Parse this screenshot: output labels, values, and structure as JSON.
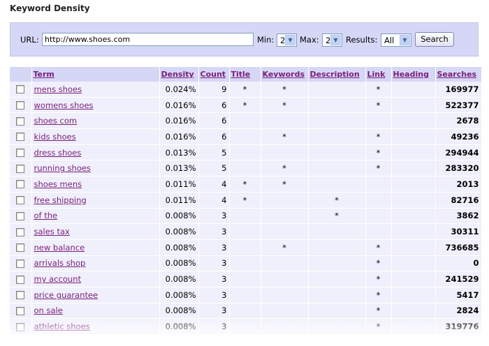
{
  "title": "Keyword Density",
  "search": {
    "url_label": "URL:",
    "url_value": "http://www.shoes.com",
    "min_label": "Min:",
    "min_value": "2",
    "max_label": "Max:",
    "max_value": "2",
    "results_label": "Results:",
    "results_value": "All",
    "button_label": "Search"
  },
  "table": {
    "headers": [
      "Term",
      "Density",
      "Count",
      "Title",
      "Keywords",
      "Description",
      "Link",
      "Heading",
      "Searches"
    ],
    "rows": [
      {
        "term": "mens shoes",
        "density": "0.024%",
        "count": "9",
        "title": "*",
        "keywords": "*",
        "description": "",
        "link": "*",
        "heading": "",
        "searches": "169977"
      },
      {
        "term": "womens shoes",
        "density": "0.016%",
        "count": "6",
        "title": "*",
        "keywords": "*",
        "description": "",
        "link": "*",
        "heading": "",
        "searches": "522377"
      },
      {
        "term": "shoes com",
        "density": "0.016%",
        "count": "6",
        "title": "",
        "keywords": "",
        "description": "",
        "link": "",
        "heading": "",
        "searches": "2678"
      },
      {
        "term": "kids shoes",
        "density": "0.016%",
        "count": "6",
        "title": "",
        "keywords": "*",
        "description": "",
        "link": "*",
        "heading": "",
        "searches": "49236"
      },
      {
        "term": "dress shoes",
        "density": "0.013%",
        "count": "5",
        "title": "",
        "keywords": "",
        "description": "",
        "link": "*",
        "heading": "",
        "searches": "294944"
      },
      {
        "term": "running shoes",
        "density": "0.013%",
        "count": "5",
        "title": "",
        "keywords": "*",
        "description": "",
        "link": "*",
        "heading": "",
        "searches": "283320"
      },
      {
        "term": "shoes mens",
        "density": "0.011%",
        "count": "4",
        "title": "*",
        "keywords": "*",
        "description": "",
        "link": "",
        "heading": "",
        "searches": "2013"
      },
      {
        "term": "free shipping",
        "density": "0.011%",
        "count": "4",
        "title": "*",
        "keywords": "",
        "description": "*",
        "link": "",
        "heading": "",
        "searches": "82716"
      },
      {
        "term": "of the",
        "density": "0.008%",
        "count": "3",
        "title": "",
        "keywords": "",
        "description": "*",
        "link": "",
        "heading": "",
        "searches": "3862"
      },
      {
        "term": "sales tax",
        "density": "0.008%",
        "count": "3",
        "title": "",
        "keywords": "",
        "description": "",
        "link": "",
        "heading": "",
        "searches": "30311"
      },
      {
        "term": "new balance",
        "density": "0.008%",
        "count": "3",
        "title": "",
        "keywords": "*",
        "description": "",
        "link": "*",
        "heading": "",
        "searches": "736685"
      },
      {
        "term": "arrivals shop",
        "density": "0.008%",
        "count": "3",
        "title": "",
        "keywords": "",
        "description": "",
        "link": "*",
        "heading": "",
        "searches": "0"
      },
      {
        "term": "my account",
        "density": "0.008%",
        "count": "3",
        "title": "",
        "keywords": "",
        "description": "",
        "link": "*",
        "heading": "",
        "searches": "241529"
      },
      {
        "term": "price guarantee",
        "density": "0.008%",
        "count": "3",
        "title": "",
        "keywords": "",
        "description": "",
        "link": "*",
        "heading": "",
        "searches": "5417"
      },
      {
        "term": "on sale",
        "density": "0.008%",
        "count": "3",
        "title": "",
        "keywords": "",
        "description": "",
        "link": "*",
        "heading": "",
        "searches": "2824"
      },
      {
        "term": "athletic shoes",
        "density": "0.008%",
        "count": "3",
        "title": "",
        "keywords": "",
        "description": "",
        "link": "*",
        "heading": "",
        "searches": "319776"
      }
    ]
  }
}
